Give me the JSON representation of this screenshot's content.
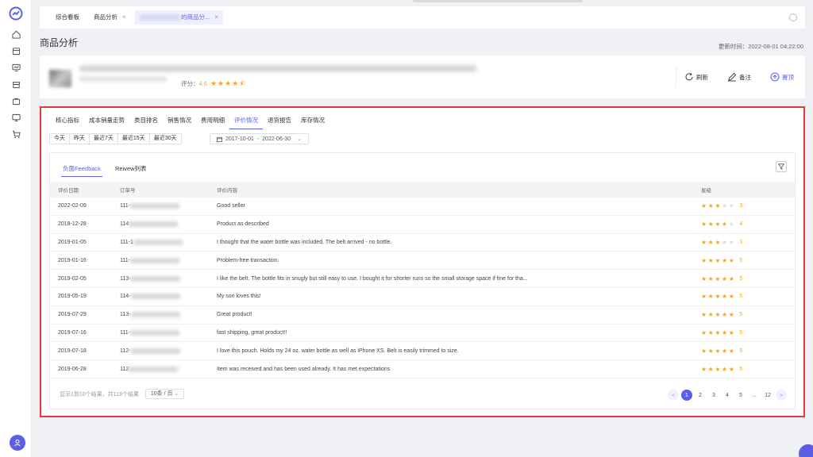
{
  "tabs": [
    {
      "label": "综合看板",
      "closable": false
    },
    {
      "label": "商品分析",
      "closable": true
    },
    {
      "label": "的商品分...",
      "closable": true,
      "active": true
    }
  ],
  "page_title": "商品分析",
  "update_time": "更新时间：2022-08-01 04:22:00",
  "product": {
    "rating_label": "评分：",
    "rating_value": "4.6",
    "rating_stars": "★★★★⯪"
  },
  "actions": {
    "refresh": "刷新",
    "note": "备注",
    "export": "置顶"
  },
  "subtabs": [
    "核心指标",
    "成本销量走势",
    "类目排名",
    "销售情况",
    "费用明细",
    "评价情况",
    "退货报告",
    "库存情况"
  ],
  "active_subtab": 5,
  "date_buttons": [
    "今天",
    "昨天",
    "最近7天",
    "最近15天",
    "最近30天"
  ],
  "date_range": {
    "start": "2017-10-01",
    "sep": "-",
    "end": "2022-06-30"
  },
  "inner_tabs": [
    "负面Feedback",
    "Reivew列表"
  ],
  "table": {
    "headers": [
      "评价日期",
      "订单号",
      "评价内容",
      "星级"
    ],
    "rows": [
      {
        "date": "2022-02-09",
        "order": "111-",
        "content": "Good seller",
        "stars": 3
      },
      {
        "date": "2018-12-28",
        "order": "114",
        "content": "Product as described",
        "stars": 4
      },
      {
        "date": "2019-01-05",
        "order": "111-1",
        "content": "I thought that the water bottle was included. The belt arrived - no bottle.",
        "stars": 3
      },
      {
        "date": "2019-01-16",
        "order": "111-",
        "content": "Problem-free transaction.",
        "stars": 5
      },
      {
        "date": "2019-02-05",
        "order": "113-",
        "content": "I like the belt. The bottle fits in snugly but still easy to use. I bought it for shorter runs so the small storage space if fine for tha...",
        "stars": 5
      },
      {
        "date": "2019-05-19",
        "order": "114-",
        "content": "My son loves this!",
        "stars": 5
      },
      {
        "date": "2019-07-29",
        "order": "113-",
        "content": "Great product!",
        "stars": 5
      },
      {
        "date": "2019-07-16",
        "order": "111-",
        "content": "fast shipping, great product!!",
        "stars": 5
      },
      {
        "date": "2019-07-18",
        "order": "112-",
        "content": "I love this pouch. Holds my 24 oz. water bottle as well as iPhone XS. Belt is easily trimmed to size.",
        "stars": 5
      },
      {
        "date": "2019-06-28",
        "order": "112",
        "content": "Item was received and has been used already. It has met expectations",
        "stars": 5
      }
    ]
  },
  "footer": {
    "summary": "显示1到10个结果，共118个结果",
    "page_size": "10条 / 页"
  },
  "pager": [
    "1",
    "2",
    "3",
    "4",
    "5",
    "...",
    "12"
  ],
  "colors": {
    "accent": "#5b5fe8",
    "star": "#f5a623",
    "highlight_border": "#e53935"
  }
}
